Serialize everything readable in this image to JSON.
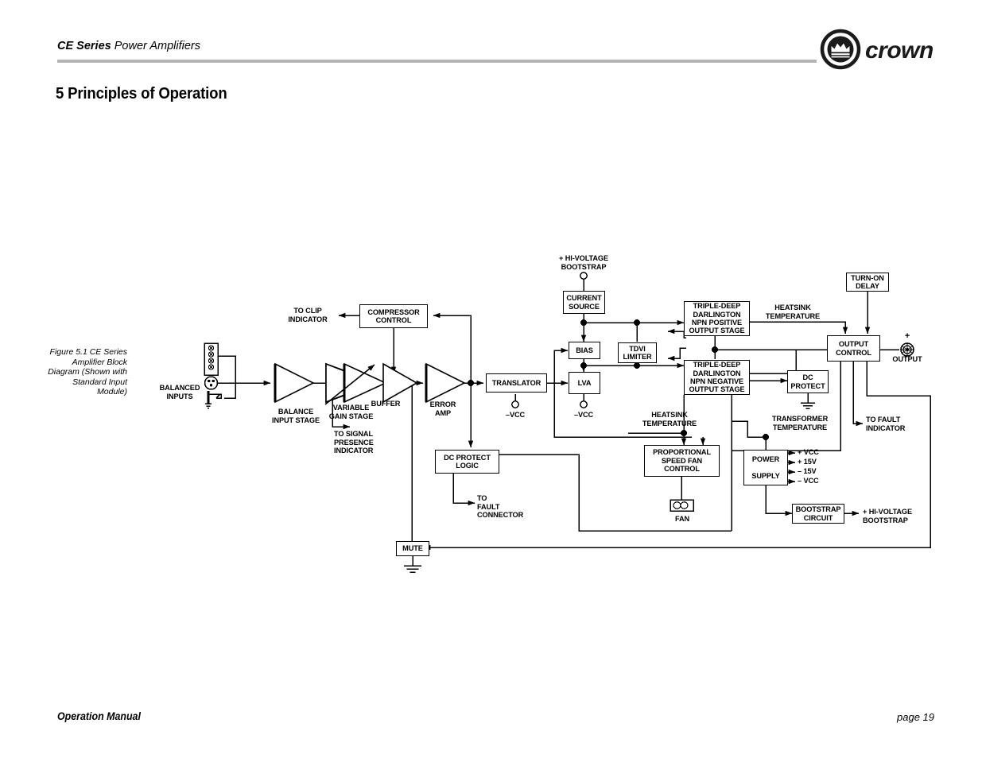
{
  "header": {
    "title_bold": "CE Series",
    "title_rest": " Power Amplifiers",
    "logo_wordmark": "crown"
  },
  "page_title": "5 Principles of Operation",
  "footer": {
    "left": "Operation Manual",
    "right": "page 19"
  },
  "figure": {
    "caption": "Figure 5.1\nCE Series\nAmplifier Block\nDiagram\n(Shown with\nStandard Input\nModule)"
  },
  "diagram": {
    "blocks": [
      {
        "id": "compressor_control",
        "label": "COMPRESSOR\nCONTROL"
      },
      {
        "id": "current_source",
        "label": "CURRENT\nSOURCE"
      },
      {
        "id": "bias",
        "label": "BIAS"
      },
      {
        "id": "lva",
        "label": "LVA"
      },
      {
        "id": "tdvi_limiter",
        "label": "TDVI\nLIMITER"
      },
      {
        "id": "translator",
        "label": "TRANSLATOR"
      },
      {
        "id": "darlington_positive",
        "label": "TRIPLE-DEEP\nDARLINGTON\nNPN POSITIVE\nOUTPUT STAGE"
      },
      {
        "id": "darlington_negative",
        "label": "TRIPLE-DEEP\nDARLINGTON\nNPN NEGATIVE\nOUTPUT STAGE"
      },
      {
        "id": "turn_on_delay",
        "label": "TURN-ON\nDELAY"
      },
      {
        "id": "output_control",
        "label": "OUTPUT\nCONTROL"
      },
      {
        "id": "dc_protect",
        "label": "DC\nPROTECT"
      },
      {
        "id": "dc_protect_logic",
        "label": "DC PROTECT\nLOGIC"
      },
      {
        "id": "fan_control",
        "label": "PROPORTIONAL\nSPEED\nFAN\nCONTROL"
      },
      {
        "id": "power_supply_top",
        "label": "POWER"
      },
      {
        "id": "power_supply_bottom",
        "label": "SUPPLY"
      },
      {
        "id": "bootstrap_circuit",
        "label": "BOOTSTRAP\nCIRCUIT"
      },
      {
        "id": "mute",
        "label": "MUTE"
      }
    ],
    "amplifiers": [
      {
        "id": "balance_input_stage",
        "label": "BALANCE\nINPUT STAGE"
      },
      {
        "id": "variable_gain_stage",
        "label": "VARIABLE\nGAIN STAGE"
      },
      {
        "id": "buffer",
        "label": "BUFFER"
      },
      {
        "id": "error_amp",
        "label": "ERROR\nAMP"
      }
    ],
    "labels": [
      {
        "id": "balanced_inputs",
        "text": "BALANCED\nINPUTS"
      },
      {
        "id": "to_clip_indicator",
        "text": "TO CLIP\nINDICATOR"
      },
      {
        "id": "to_signal_presence_indicator",
        "text": "TO SIGNAL\nPRESENCE\nINDICATOR"
      },
      {
        "id": "hi_voltage_bootstrap_top",
        "text": "+ HI-VOLTAGE\nBOOTSTRAP"
      },
      {
        "id": "vcc_translator",
        "text": "–VCC"
      },
      {
        "id": "vcc_lva",
        "text": "–VCC"
      },
      {
        "id": "heatsink_temperature_top",
        "text": "HEATSINK\nTEMPERATURE"
      },
      {
        "id": "heatsink_temperature_bottom",
        "text": "HEATSINK\nTEMPERATURE"
      },
      {
        "id": "transformer_temperature",
        "text": "TRANSFORMER\nTEMPERATURE"
      },
      {
        "id": "to_fault_indicator",
        "text": "TO FAULT\nINDICATOR"
      },
      {
        "id": "to_fault_connector",
        "text": "TO\nFAULT\nCONNECTOR"
      },
      {
        "id": "fan",
        "text": "FAN"
      },
      {
        "id": "output",
        "text": "OUTPUT"
      },
      {
        "id": "output_plus",
        "text": "+"
      },
      {
        "id": "rail_plus_vcc",
        "text": "+ VCC"
      },
      {
        "id": "rail_plus_15v",
        "text": "+ 15V"
      },
      {
        "id": "rail_minus_15v",
        "text": "– 15V"
      },
      {
        "id": "rail_minus_vcc",
        "text": "– VCC"
      },
      {
        "id": "hi_voltage_bootstrap_out",
        "text": "+ HI-VOLTAGE\nBOOTSTRAP"
      }
    ]
  },
  "colors": {
    "line": "#000000",
    "rule": "#b5b5b5",
    "background": "#ffffff"
  }
}
